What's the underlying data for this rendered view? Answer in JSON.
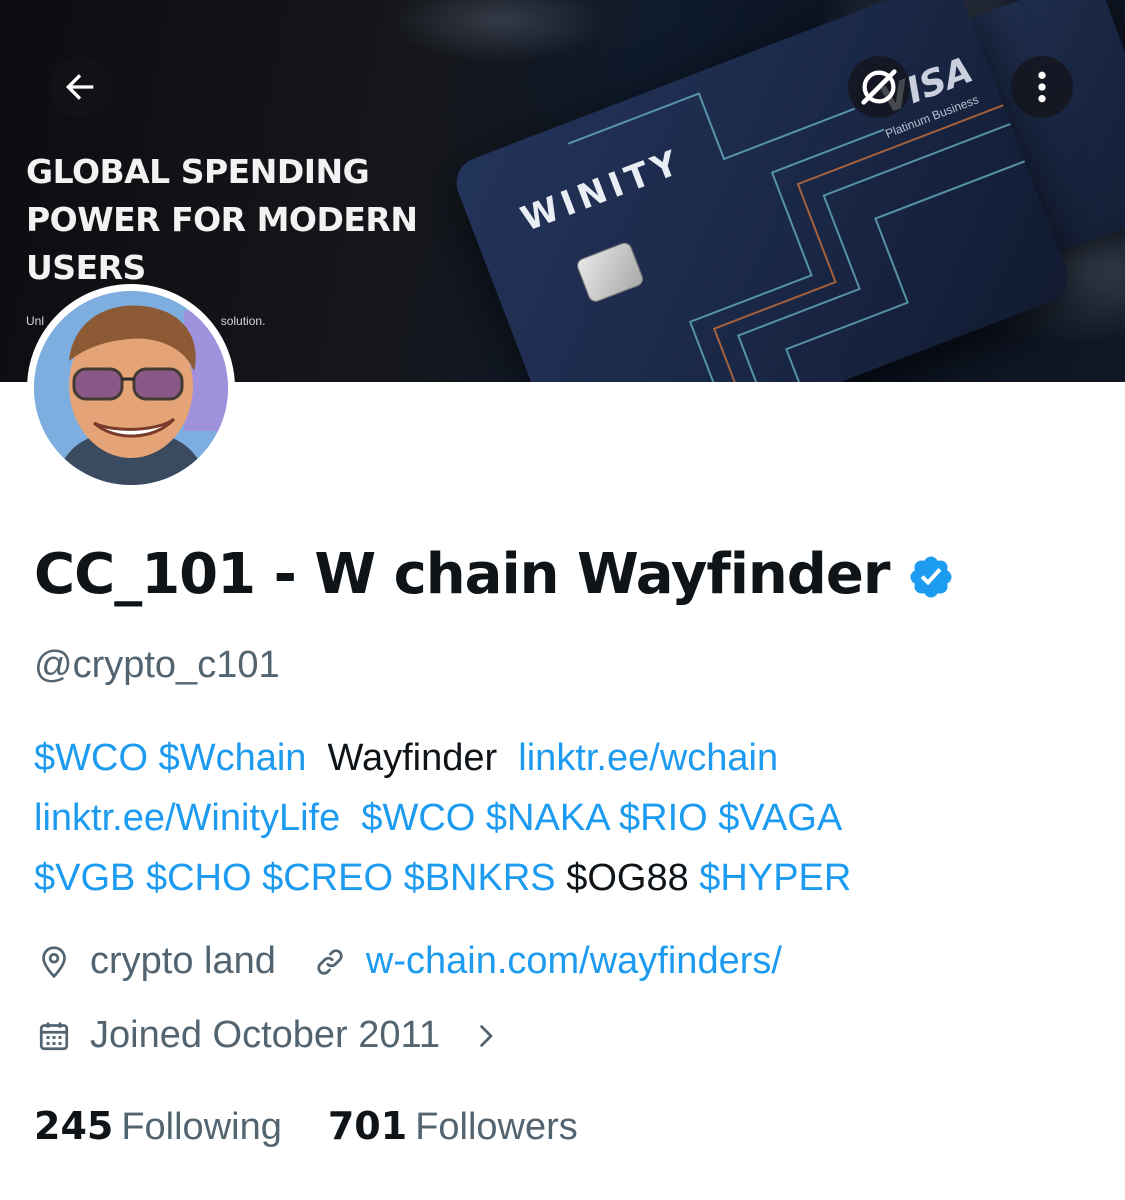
{
  "banner": {
    "headline_lines": [
      "GLOBAL SPENDING",
      "POWER FOR MODERN",
      "USERS"
    ],
    "subline_start": "Unl",
    "subline_end": "solution.",
    "card_brand": "WINITY",
    "card_network": "VISA",
    "card_tier": "Platinum Business"
  },
  "header_buttons": {
    "back_icon": "arrow-left-icon",
    "grok_icon": "grok-slash-icon",
    "more_icon": "more-vertical-icon"
  },
  "profile": {
    "display_name": "CC_101 - W chain Wayfinder",
    "verified_icon": "verified-badge-icon",
    "verified_color": "#1d9bf0",
    "handle": "@crypto_c101",
    "bio": {
      "line1": [
        {
          "text": "$WCO",
          "type": "link"
        },
        {
          "text": " ",
          "type": "plain"
        },
        {
          "text": "$Wchain",
          "type": "link"
        },
        {
          "text": "  Wayfinder  ",
          "type": "plain"
        },
        {
          "text": "linktr.ee/wchain",
          "type": "link"
        }
      ],
      "line2": [
        {
          "text": "linktr.ee/WinityLife",
          "type": "link"
        },
        {
          "text": "  ",
          "type": "plain"
        },
        {
          "text": "$WCO",
          "type": "link"
        },
        {
          "text": " ",
          "type": "plain"
        },
        {
          "text": "$NAKA",
          "type": "link"
        },
        {
          "text": " ",
          "type": "plain"
        },
        {
          "text": "$RIO",
          "type": "link"
        },
        {
          "text": " ",
          "type": "plain"
        },
        {
          "text": "$VAGA",
          "type": "link"
        }
      ],
      "line3": [
        {
          "text": "$VGB",
          "type": "link"
        },
        {
          "text": " ",
          "type": "plain"
        },
        {
          "text": "$CHO",
          "type": "link"
        },
        {
          "text": " ",
          "type": "plain"
        },
        {
          "text": "$CREO",
          "type": "link"
        },
        {
          "text": " ",
          "type": "plain"
        },
        {
          "text": "$BNKRS",
          "type": "link"
        },
        {
          "text": " $OG88 ",
          "type": "plain"
        },
        {
          "text": "$HYPER",
          "type": "link"
        }
      ]
    },
    "location": "crypto land",
    "location_icon": "location-pin-icon",
    "website": "w-chain.com/wayfinders/",
    "website_icon": "link-icon",
    "joined": "Joined October 2011",
    "joined_icon": "calendar-icon",
    "joined_chevron_icon": "chevron-right-icon"
  },
  "stats": {
    "following_count": "245",
    "following_label": "Following",
    "followers_count": "701",
    "followers_label": "Followers"
  },
  "colors": {
    "link": "#1d9bf0",
    "text_primary": "#0f1419",
    "text_secondary": "#536471"
  }
}
